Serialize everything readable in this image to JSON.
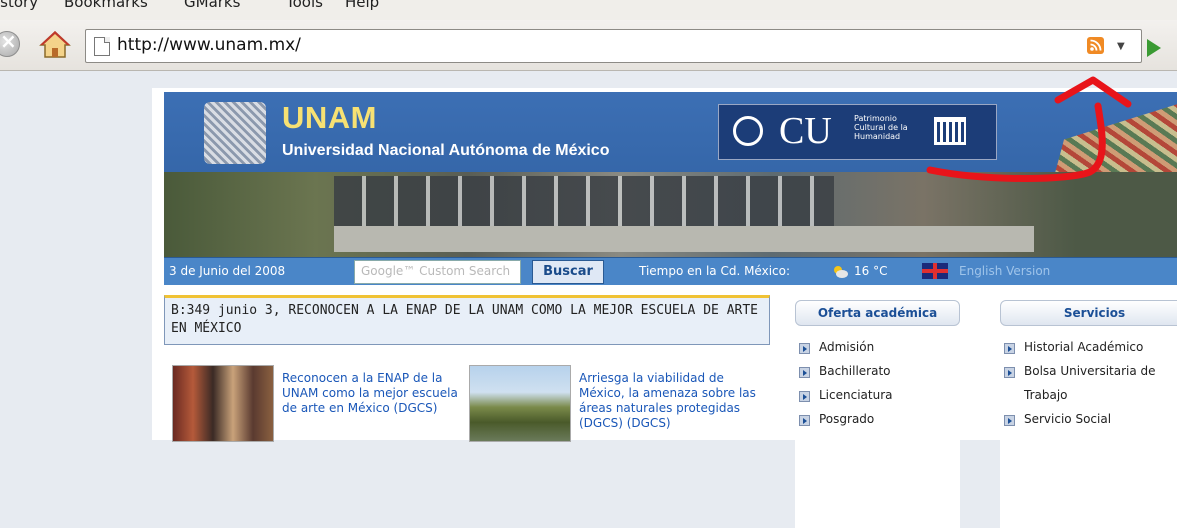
{
  "menu": {
    "items": [
      "istory",
      "Bookmarks",
      "GMarks",
      "Tools",
      "Help"
    ]
  },
  "toolbar": {
    "url": "http://www.unam.mx/"
  },
  "header": {
    "brand": "UNAM",
    "subtitle": "Universidad Nacional Autónoma de México",
    "badge_text": "CU",
    "badge_sub": "Patrimonio Cultural de la Humanidad"
  },
  "infobar": {
    "date": "3 de Junio del 2008",
    "search_placeholder": "Google™ Custom Search",
    "search_button": "Buscar",
    "weather_label": "Tiempo en la Cd. México:",
    "temperature": "16 °C",
    "english": "English Version"
  },
  "headline": "B:349 junio 3, RECONOCEN A LA ENAP DE LA UNAM COMO LA MEJOR ESCUELA DE ARTE EN MÉXICO",
  "news": [
    {
      "text": "Reconocen a la ENAP de la UNAM como la mejor escuela de arte en México (DGCS)"
    },
    {
      "text": "Arriesga la viabilidad de México, la amenaza sobre las áreas naturales protegidas (DGCS) (DGCS)"
    }
  ],
  "oferta": {
    "title": "Oferta académica",
    "items": [
      "Admisión",
      "Bachillerato",
      "Licenciatura",
      "Posgrado"
    ]
  },
  "servicios": {
    "title": "Servicios",
    "items": [
      "Historial Académico",
      "Bolsa Universitaria de",
      "Trabajo",
      "Servicio Social"
    ]
  },
  "colors": {
    "accent": "#2e5e9e",
    "headline_border": "#f0c234",
    "link": "#1a57b8",
    "annotation": "#e8141a"
  }
}
